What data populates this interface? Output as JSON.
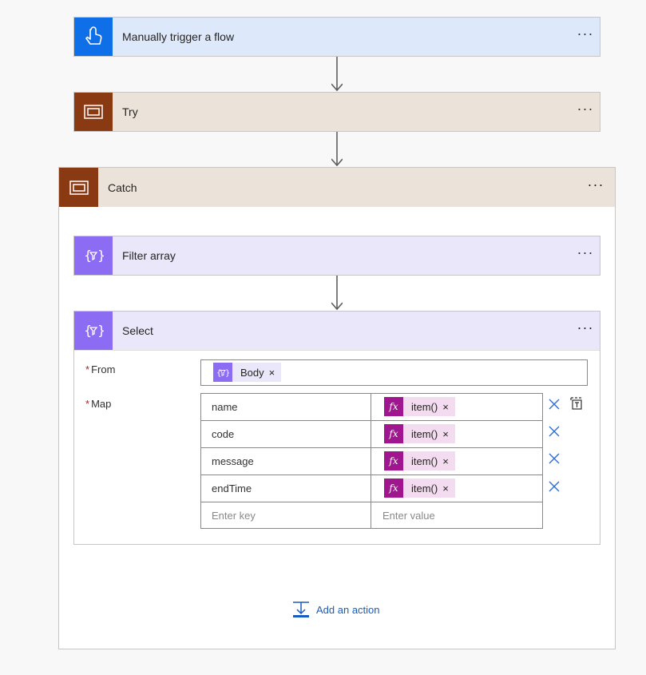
{
  "trigger": {
    "title": "Manually trigger a flow",
    "menu": "···",
    "icon": "touch-hand-icon",
    "color": "#0f6fe8"
  },
  "try": {
    "title": "Try",
    "menu": "···",
    "icon": "scope-icon",
    "color": "#8a3a12"
  },
  "catch": {
    "title": "Catch",
    "menu": "···",
    "icon": "scope-icon",
    "color": "#8a3a12"
  },
  "filter": {
    "title": "Filter array",
    "menu": "···",
    "icon": "data-operation-icon",
    "color": "#8c6cf2"
  },
  "select": {
    "title": "Select",
    "menu": "···",
    "icon": "data-operation-icon",
    "from_label": "From",
    "map_label": "Map",
    "required_mark": "*",
    "from_token": {
      "label": "Body",
      "remove": "×"
    },
    "map_rows": [
      {
        "key": "name",
        "value": "item()",
        "remove": "×"
      },
      {
        "key": "code",
        "value": "item()",
        "remove": "×"
      },
      {
        "key": "message",
        "value": "item()",
        "remove": "×"
      },
      {
        "key": "endTime",
        "value": "item()",
        "remove": "×"
      }
    ],
    "key_placeholder": "Enter key",
    "value_placeholder": "Enter value",
    "fx_symbol": "fx"
  },
  "add_action": {
    "label": "Add an action"
  }
}
